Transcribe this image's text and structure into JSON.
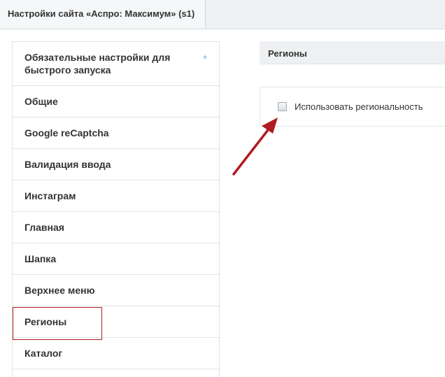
{
  "header": {
    "tab_title": "Настройки сайта «Аспро: Максимум» (s1)"
  },
  "sidebar": {
    "first_item": {
      "label_line1": "Обязательные настройки для",
      "label_line2": "быстрого запуска",
      "marker": "*"
    },
    "items": [
      {
        "label": "Общие"
      },
      {
        "label": "Google reCaptcha"
      },
      {
        "label": "Валидация ввода"
      },
      {
        "label": "Инстаграм"
      },
      {
        "label": "Главная"
      },
      {
        "label": "Шапка"
      },
      {
        "label": "Верхнее меню"
      },
      {
        "label": "Регионы"
      },
      {
        "label": "Каталог"
      }
    ],
    "selected": "Регионы"
  },
  "main": {
    "section_title": "Регионы",
    "option": {
      "label": "Использовать региональность",
      "checked": false
    }
  },
  "colors": {
    "highlight_border": "#b01c22",
    "arrow": "#b01c22",
    "marker": "#a5c7de"
  }
}
